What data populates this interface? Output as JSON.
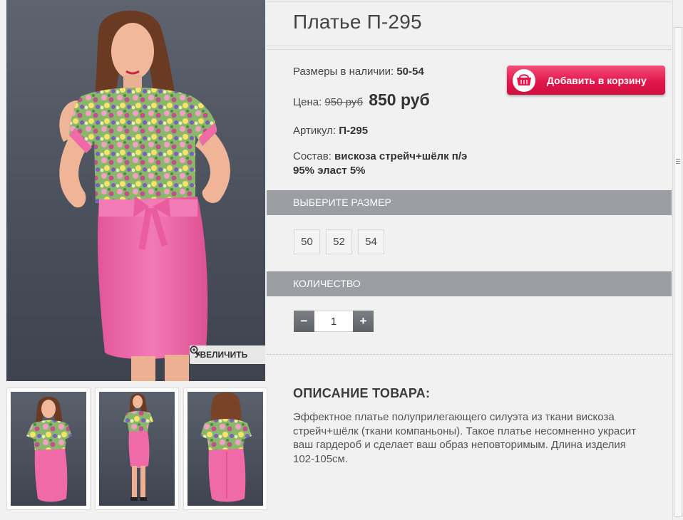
{
  "product": {
    "title": "Платье П-295",
    "sizes_label": "Размеры в наличии:",
    "sizes_value": "50-54",
    "price_label": "Цена:",
    "old_price": "950 руб",
    "new_price": "850 руб",
    "article_label": "Артикул:",
    "article_value": "П-295",
    "composition_label": "Состав:",
    "composition_line1": "вискоза стрейч+шёлк п/э",
    "composition_line2": "95% эласт 5%"
  },
  "cart_button": {
    "label": "Добавить в корзину",
    "icon": "basket-icon",
    "color": "#e3174c"
  },
  "gallery": {
    "zoom_label": "УВЕЛИЧИТЬ",
    "zoom_icon": "magnifier-plus-icon",
    "thumbnails": [
      "front",
      "full-length",
      "back"
    ]
  },
  "size_section": {
    "header": "ВЫБЕРИТЕ РАЗМЕР",
    "options": [
      "50",
      "52",
      "54"
    ]
  },
  "quantity_section": {
    "header": "КОЛИЧЕСТВО",
    "minus": "−",
    "value": "1",
    "plus": "+"
  },
  "description": {
    "title": "ОПИСАНИЕ ТОВАРА:",
    "text": "Эффектное платье полуприлегающего силуэта из ткани вискоза стрейч+шёлк (ткани компаньоны). Такое платье несомненно украсит ваш гардероб и сделает ваш образ неповторимым. Длина изделия 102-105см."
  },
  "colors": {
    "section_bar": "#9b9ea3",
    "skirt": "#f06aa8",
    "background": "#f1f1f1"
  }
}
